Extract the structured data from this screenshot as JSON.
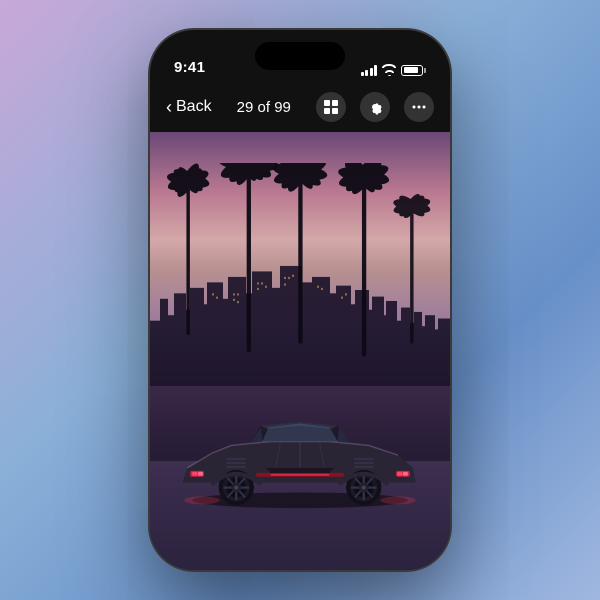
{
  "background": {
    "gradient": "linear-gradient(135deg, #c8a8d8, #8ab0d8, #6890c8)"
  },
  "phone": {
    "status_bar": {
      "time": "9:41"
    },
    "nav_bar": {
      "back_label": "Back",
      "counter": "29 of 99",
      "icons": [
        {
          "name": "grid-icon",
          "symbol": "⊞"
        },
        {
          "name": "settings-icon",
          "symbol": "⚙"
        },
        {
          "name": "more-icon",
          "symbol": "•••"
        }
      ]
    },
    "photo": {
      "description": "Retrowave sports car with palm trees and city skyline at dusk"
    }
  }
}
